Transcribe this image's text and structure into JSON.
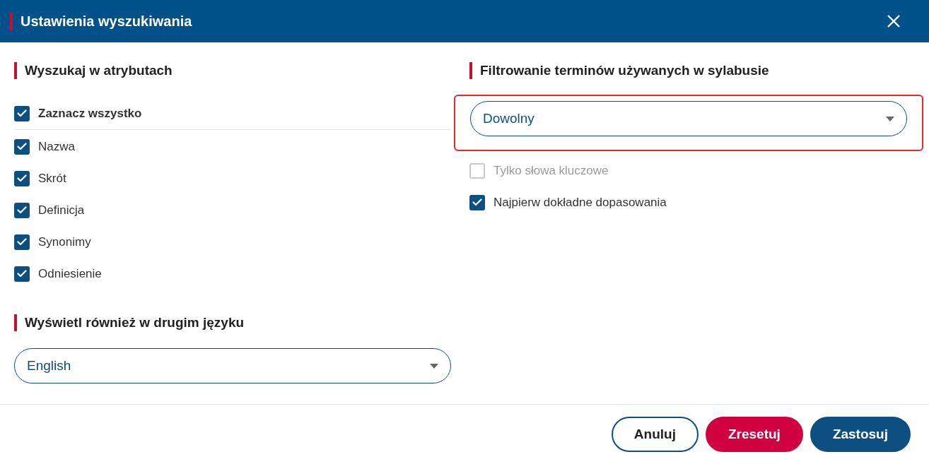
{
  "dialog": {
    "title": "Ustawienia wyszukiwania"
  },
  "attributes": {
    "heading": "Wyszukaj w atrybutach",
    "select_all": {
      "label": "Zaznacz wszystko",
      "checked": true
    },
    "items": [
      {
        "label": "Nazwa",
        "checked": true
      },
      {
        "label": "Skrót",
        "checked": true
      },
      {
        "label": "Definicja",
        "checked": true
      },
      {
        "label": "Synonimy",
        "checked": true
      },
      {
        "label": "Odniesienie",
        "checked": true
      }
    ]
  },
  "second_language": {
    "heading": "Wyświetl również w drugim języku",
    "value": "English"
  },
  "filter": {
    "heading": "Filtrowanie terminów używanych w sylabusie",
    "value": "Dowolny",
    "highlighted": true,
    "options": [
      {
        "label": "Tylko słowa kluczowe",
        "checked": false,
        "disabled": true
      },
      {
        "label": "Najpierw dokładne dopasowania",
        "checked": true,
        "disabled": false
      }
    ]
  },
  "buttons": [
    {
      "label": "Anuluj",
      "kind": "outline"
    },
    {
      "label": "Zresetuj",
      "kind": "danger"
    },
    {
      "label": "Zastosuj",
      "kind": "primary"
    }
  ]
}
